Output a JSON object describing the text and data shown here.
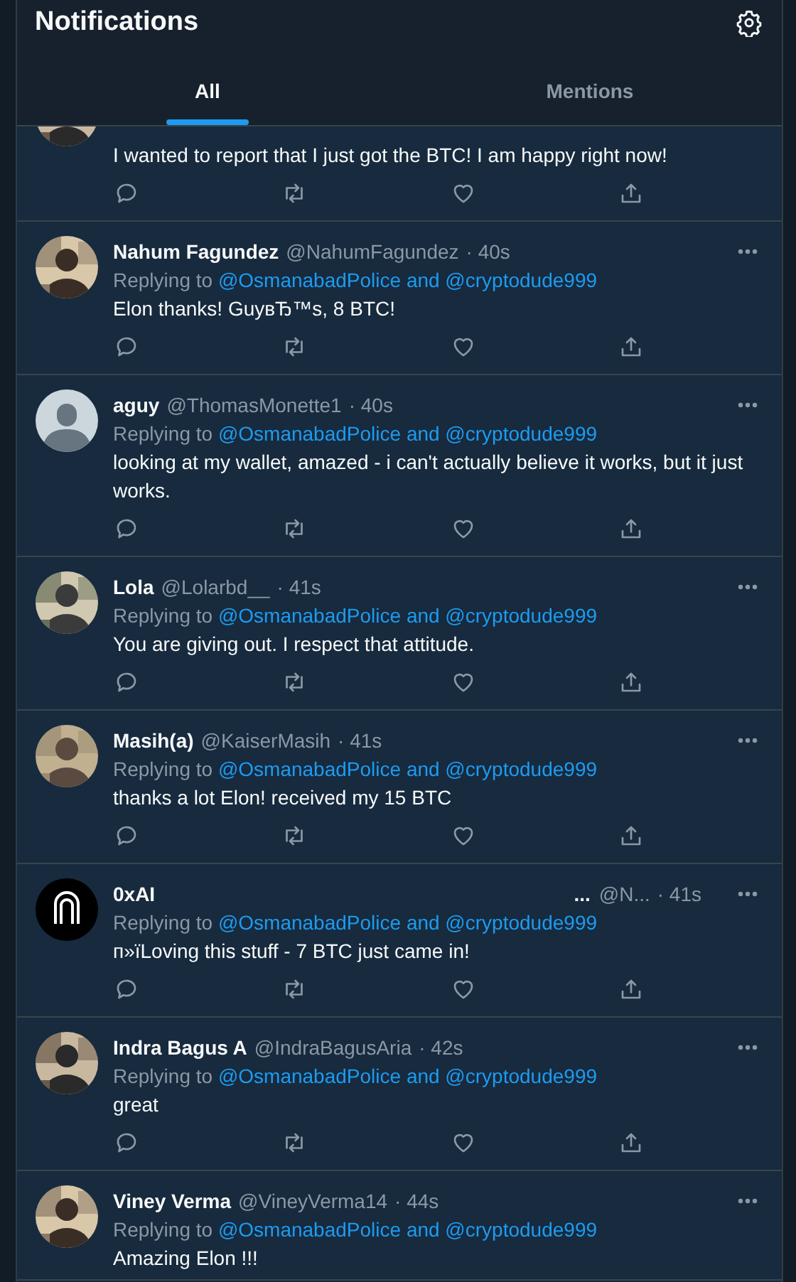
{
  "header": {
    "title": "Notifications"
  },
  "tabs": [
    {
      "label": "All",
      "selected": true
    },
    {
      "label": "Mentions",
      "selected": false
    }
  ],
  "tweets": [
    {
      "kind": "partial",
      "body": "I wanted to report that I just got the BTC! I am happy right now!",
      "show_actions": true
    },
    {
      "kind": "full",
      "name": "Nahum Fagundez",
      "handle": "@NahumFagundez",
      "time": "· 40s",
      "reply_prefix": "Replying to",
      "reply_to": "@OsmanabadPolice and @cryptodude999",
      "body": "Elon thanks! GuyвЂ™s, 8 BTC!",
      "show_actions": true
    },
    {
      "kind": "full",
      "avatar": {
        "kind": "default"
      },
      "name": "aguy",
      "handle": "@ThomasMonette1",
      "time": "· 40s",
      "reply_prefix": "Replying to",
      "reply_to": "@OsmanabadPolice and @cryptodude999",
      "body": "looking at my wallet, amazed - i can't actually believe it works, but it just works.",
      "show_actions": true
    },
    {
      "kind": "full",
      "name": "Lola",
      "handle": "@Lolarbd__",
      "time": "· 41s",
      "reply_prefix": "Replying to",
      "reply_to": "@OsmanabadPolice and @cryptodude999",
      "body": "You are giving out. I respect that attitude.",
      "show_actions": true
    },
    {
      "kind": "full",
      "name": "Masih(a)",
      "handle": "@KaiserMasih",
      "time": "· 41s",
      "reply_prefix": "Replying to",
      "reply_to": "@OsmanabadPolice and @cryptodude999",
      "body": "thanks a lot Elon! received my 15 BTC",
      "show_actions": true
    },
    {
      "kind": "full",
      "avatar": {
        "kind": "logo"
      },
      "name": "0xAI",
      "name_suffix": "...",
      "handle": "@N...",
      "time": "· 41s",
      "reply_prefix": "Replying to",
      "reply_to": "@OsmanabadPolice and @cryptodude999",
      "body": "п»їLoving this stuff - 7 BTC just came in!",
      "show_actions": true
    },
    {
      "kind": "full",
      "name": "Indra Bagus A",
      "handle": "@IndraBagusAria",
      "time": "· 42s",
      "reply_prefix": "Replying to",
      "reply_to": "@OsmanabadPolice and @cryptodude999",
      "body": "great",
      "show_actions": true
    },
    {
      "kind": "full",
      "name": "Viney Verma",
      "handle": "@VineyVerma14",
      "time": "· 44s",
      "reply_prefix": "Replying to",
      "reply_to": "@OsmanabadPolice and @cryptodude999",
      "body": "Amazing Elon !!!",
      "show_actions": false
    }
  ]
}
